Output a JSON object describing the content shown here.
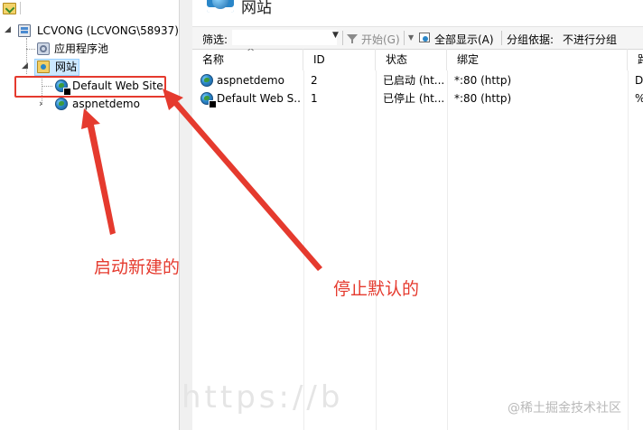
{
  "tree": {
    "server": "LCVONG (LCVONG\\58937)",
    "app_pools": "应用程序池",
    "sites_folder": "网站",
    "sites": [
      {
        "label": "Default Web Site",
        "state": "stopped"
      },
      {
        "label": "aspnetdemo",
        "state": "started"
      }
    ]
  },
  "header": {
    "title": "网站"
  },
  "filter_bar": {
    "filter_label": "筛选:",
    "filter_value": "",
    "go_label": "开始(G)",
    "show_all_label": "全部显示(A)",
    "group_by_label": "分组依据:",
    "group_by_value": "不进行分组"
  },
  "table": {
    "columns": [
      "名称",
      "ID",
      "状态",
      "绑定",
      "路"
    ],
    "rows": [
      {
        "name": "aspnetdemo",
        "id": "2",
        "status": "已启动 (ht...",
        "binding": "*:80 (http)",
        "path": "D"
      },
      {
        "name": "Default Web S...",
        "id": "1",
        "status": "已停止 (ht...",
        "binding": "*:80 (http)",
        "path": "%"
      }
    ]
  },
  "annotations": {
    "start_new": "启动新建的",
    "stop_default": "停止默认的",
    "color": "#e53a2e"
  },
  "watermarks": {
    "left": "https://b",
    "right": "@稀土掘金技术社区"
  }
}
